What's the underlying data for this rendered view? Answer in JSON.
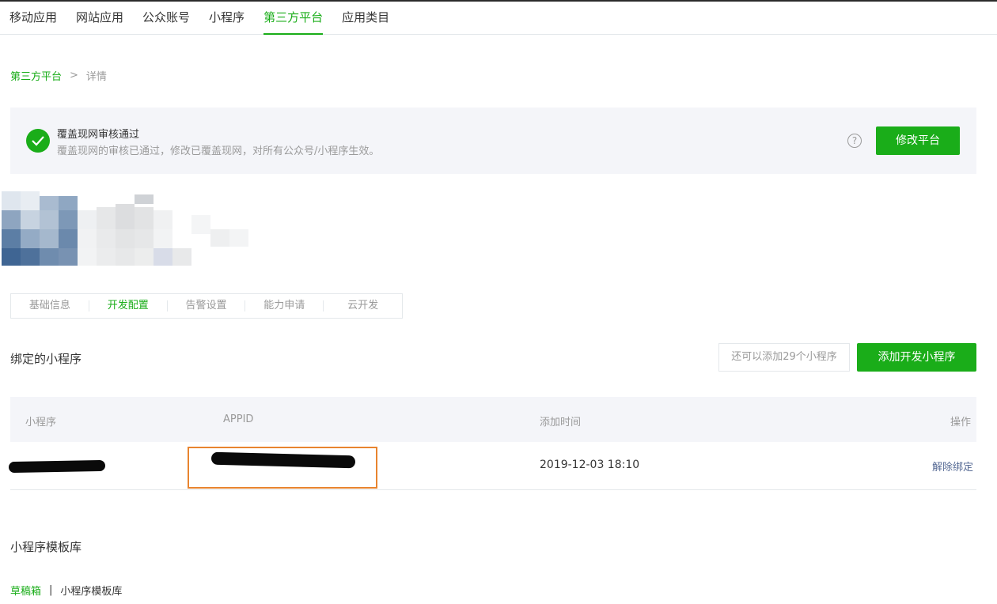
{
  "topnav": {
    "items": [
      {
        "label": "移动应用"
      },
      {
        "label": "网站应用"
      },
      {
        "label": "公众账号"
      },
      {
        "label": "小程序"
      },
      {
        "label": "第三方平台"
      },
      {
        "label": "应用类目"
      }
    ],
    "active": "第三方平台"
  },
  "breadcrumb": {
    "root": "第三方平台",
    "separator": ">",
    "current": "详情"
  },
  "status": {
    "title": "覆盖现网审核通过",
    "description": "覆盖现网的审核已通过，修改已覆盖现网，对所有公众号/小程序生效。",
    "help_glyph": "?",
    "edit_button": "修改平台"
  },
  "subtabs": {
    "items": [
      {
        "label": "基础信息"
      },
      {
        "label": "开发配置"
      },
      {
        "label": "告警设置"
      },
      {
        "label": "能力申请"
      },
      {
        "label": "云开发"
      }
    ],
    "active": "开发配置"
  },
  "bound": {
    "title": "绑定的小程序",
    "hint": "还可以添加29个小程序",
    "add_button": "添加开发小程序",
    "columns": {
      "name": "小程序",
      "appid": "APPID",
      "time": "添加时间",
      "action": "操作"
    },
    "rows": [
      {
        "name": "",
        "appid": "",
        "time": "2019-12-03 18:10",
        "action": "解除绑定"
      }
    ]
  },
  "library": {
    "title": "小程序模板库",
    "tabs": [
      {
        "label": "草稿箱"
      },
      {
        "label": "小程序模板库"
      }
    ],
    "divider": "|"
  },
  "colors": {
    "accent": "#1aad19",
    "link": "#576b95",
    "highlight_border": "#e8842f",
    "panel_bg": "#f4f5f9"
  }
}
